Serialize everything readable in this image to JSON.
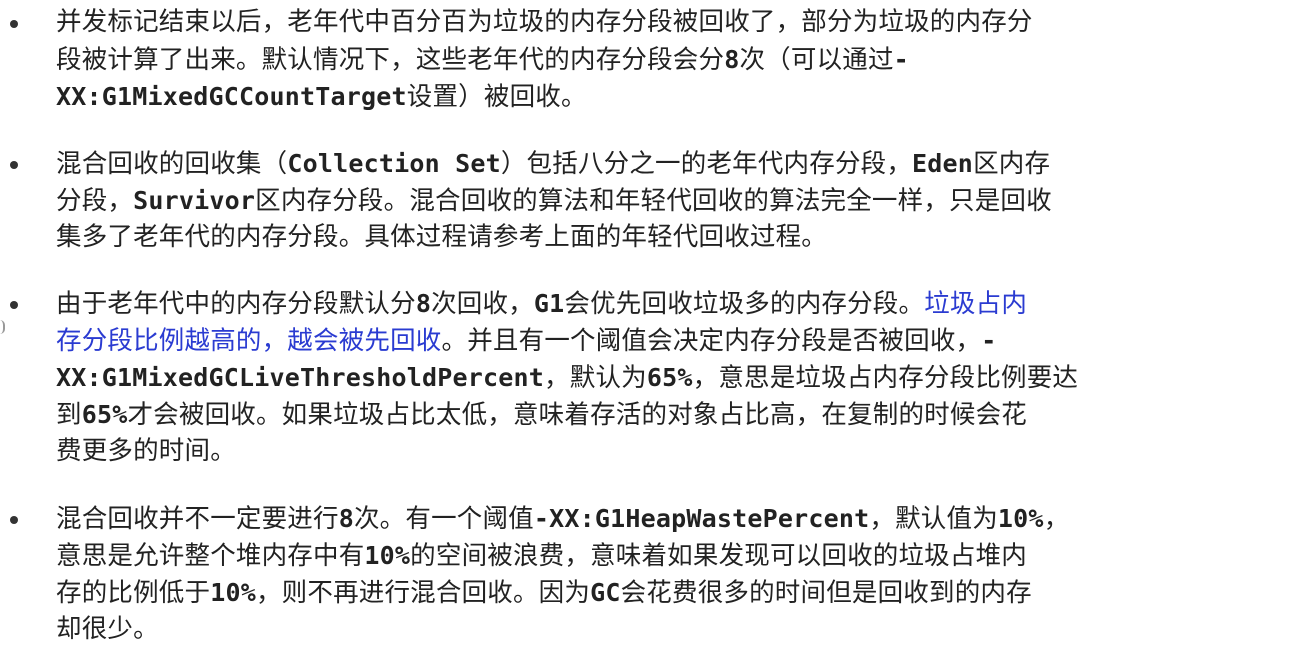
{
  "bullets": [
    {
      "lines": [
        [
          {
            "text": "并发标记结束以后，老年代中百分百为垃圾的内存分段被回收了，部分为垃圾的内存分"
          }
        ],
        [
          {
            "text": "段被计算了出来。默认情况下，这些老年代的内存分段会分"
          },
          {
            "text": "8",
            "style": "mono"
          },
          {
            "text": "次（可以通过"
          },
          {
            "text": "-",
            "style": "mono"
          }
        ],
        [
          {
            "text": "XX:G1MixedGCCountTarget",
            "style": "mono"
          },
          {
            "text": "设置）被回收。"
          }
        ]
      ]
    },
    {
      "lines": [
        [
          {
            "text": "混合回收的回收集（"
          },
          {
            "text": "Collection Set",
            "style": "mono"
          },
          {
            "text": "）包括八分之一的老年代内存分段，"
          },
          {
            "text": "Eden",
            "style": "mono"
          },
          {
            "text": "区内存"
          }
        ],
        [
          {
            "text": "分段，"
          },
          {
            "text": "Survivor",
            "style": "mono"
          },
          {
            "text": "区内存分段。混合回收的算法和年轻代回收的算法完全一样，只是回收"
          }
        ],
        [
          {
            "text": "集多了老年代的内存分段。具体过程请参考上面的年轻代回收过程。"
          }
        ]
      ]
    },
    {
      "lines": [
        [
          {
            "text": "由于老年代中的内存分段默认分"
          },
          {
            "text": "8",
            "style": "mono"
          },
          {
            "text": "次回收，"
          },
          {
            "text": "G1",
            "style": "mono"
          },
          {
            "text": "会优先回收垃圾多的内存分段。"
          },
          {
            "text": "垃圾占内",
            "style": "link"
          }
        ],
        [
          {
            "text": "存分段比例越高的，越会被先回收",
            "style": "link"
          },
          {
            "text": "。并且有一个阈值会决定内存分段是否被回收，"
          },
          {
            "text": "-",
            "style": "mono"
          }
        ],
        [
          {
            "text": "XX:G1MixedGCLiveThresholdPercent",
            "style": "mono"
          },
          {
            "text": "，默认为"
          },
          {
            "text": "65%",
            "style": "mono"
          },
          {
            "text": "，意思是垃圾占内存分段比例要达"
          }
        ],
        [
          {
            "text": "到"
          },
          {
            "text": "65%",
            "style": "mono"
          },
          {
            "text": "才会被回收。如果垃圾占比太低，意味着存活的对象占比高，在复制的时候会花"
          }
        ],
        [
          {
            "text": "费更多的时间。"
          }
        ]
      ]
    },
    {
      "lines": [
        [
          {
            "text": "混合回收并不一定要进行"
          },
          {
            "text": "8",
            "style": "mono"
          },
          {
            "text": "次。有一个阈值"
          },
          {
            "text": "-XX:G1HeapWastePercent",
            "style": "mono"
          },
          {
            "text": "，默认值为"
          },
          {
            "text": "10%",
            "style": "mono"
          },
          {
            "text": "，"
          }
        ],
        [
          {
            "text": "意思是允许整个堆内存中有"
          },
          {
            "text": "10%",
            "style": "mono"
          },
          {
            "text": "的空间被浪费，意味着如果发现可以回收的垃圾占堆内"
          }
        ],
        [
          {
            "text": "存的比例低于"
          },
          {
            "text": "10%",
            "style": "mono"
          },
          {
            "text": "，则不再进行混合回收。因为"
          },
          {
            "text": "GC",
            "style": "mono"
          },
          {
            "text": "会花费很多的时间但是回收到的内存"
          }
        ],
        [
          {
            "text": "却很少。"
          }
        ]
      ]
    }
  ],
  "colors": {
    "text": "#222222",
    "link": "#2a3bd1",
    "background": "#ffffff"
  }
}
